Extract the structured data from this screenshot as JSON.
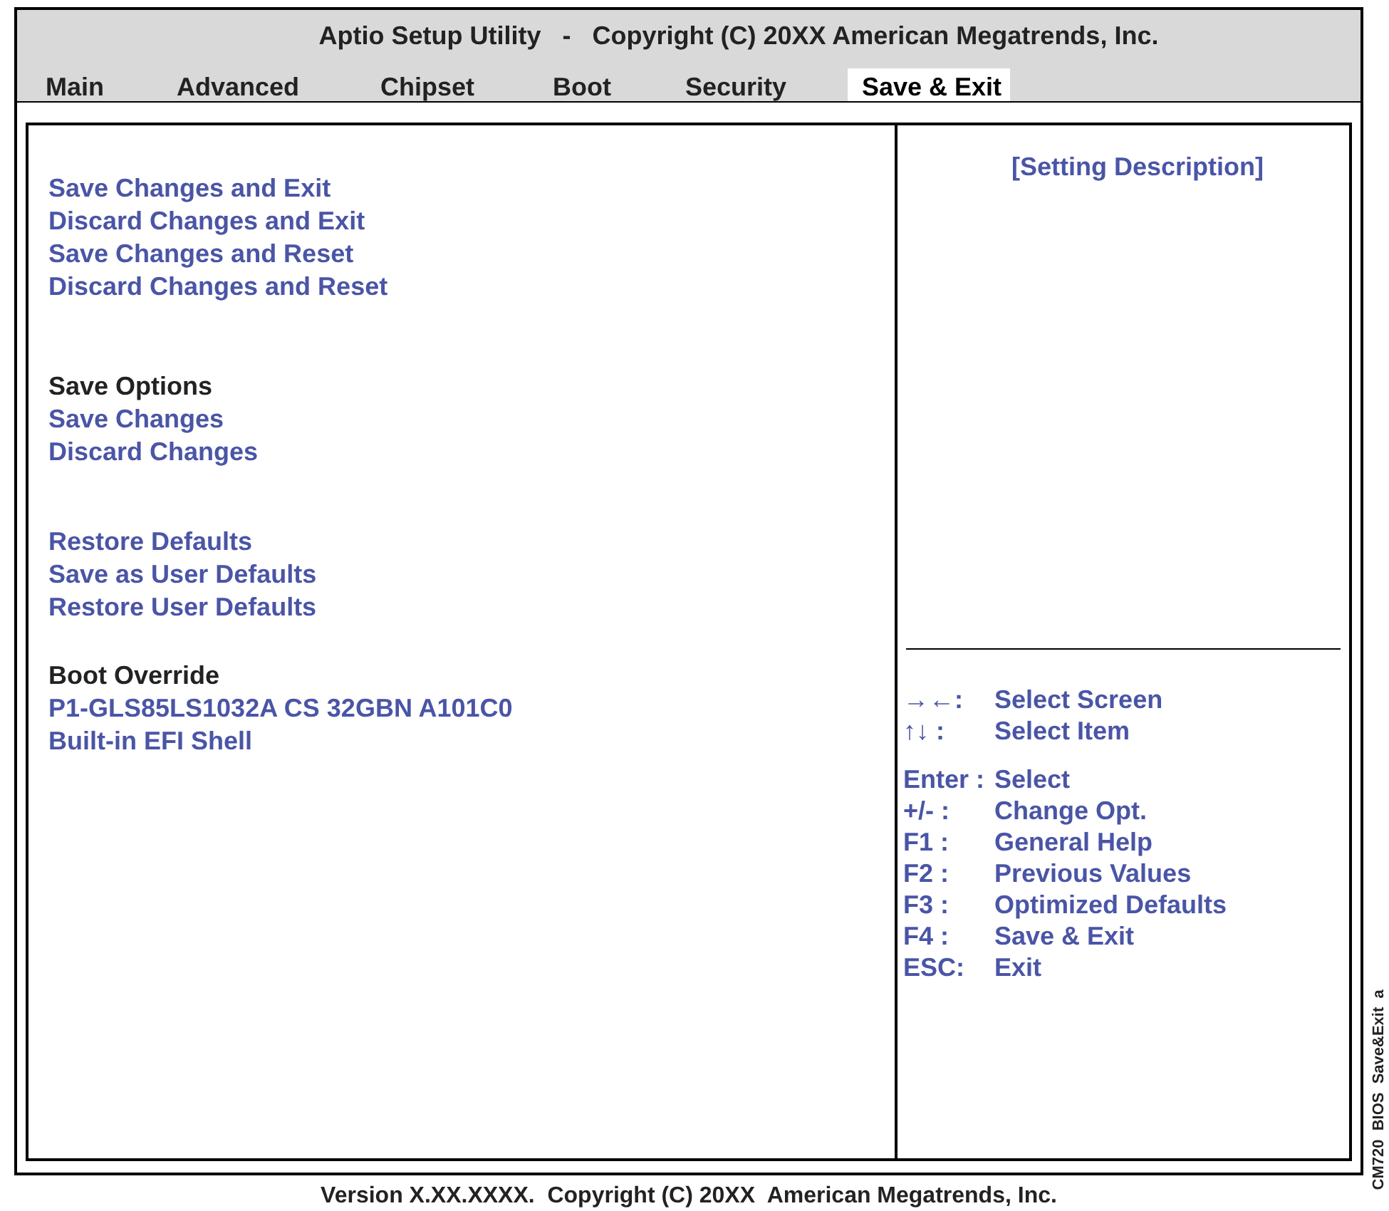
{
  "header": {
    "title": "Aptio Setup Utility   -   Copyright (C) 20XX American Megatrends, Inc."
  },
  "tabs": [
    {
      "label": "Main",
      "selected": false
    },
    {
      "label": "Advanced",
      "selected": false
    },
    {
      "label": "Chipset",
      "selected": false
    },
    {
      "label": "Boot",
      "selected": false
    },
    {
      "label": "Security",
      "selected": false
    },
    {
      "label": "Save & Exit",
      "selected": true
    }
  ],
  "menu_groups": [
    {
      "items": [
        "Save Changes and Exit",
        "Discard Changes and Exit",
        "Save Changes and Reset",
        "Discard Changes and Reset"
      ]
    },
    {
      "heading": "Save Options",
      "items": [
        "Save Changes",
        "Discard Changes"
      ]
    },
    {
      "items": [
        "Restore Defaults",
        "Save as User Defaults",
        "Restore User Defaults"
      ]
    },
    {
      "heading": "Boot Override",
      "items": [
        "P1-GLS85LS1032A CS 32GBN A101C0",
        "Built-in EFI Shell"
      ]
    }
  ],
  "help_panel": {
    "title": "[Setting Description]",
    "keys": [
      {
        "key": "→←:",
        "action": "Select Screen"
      },
      {
        "key": "↑↓ :",
        "action": "Select Item"
      },
      {
        "key": "Enter :",
        "action": "Select"
      },
      {
        "key": "+/- :",
        "action": "Change Opt."
      },
      {
        "key": "F1 :",
        "action": "General Help"
      },
      {
        "key": "F2 :",
        "action": "Previous Values"
      },
      {
        "key": "F3 :",
        "action": "Optimized Defaults"
      },
      {
        "key": "F4 :",
        "action": "Save & Exit"
      },
      {
        "key": "ESC:",
        "action": "Exit"
      }
    ]
  },
  "footer": "Version X.XX.XXXX.  Copyright (C) 20XX  American Megatrends, Inc.",
  "figure_label": "CM720  BIOS  Save&Exit  a"
}
